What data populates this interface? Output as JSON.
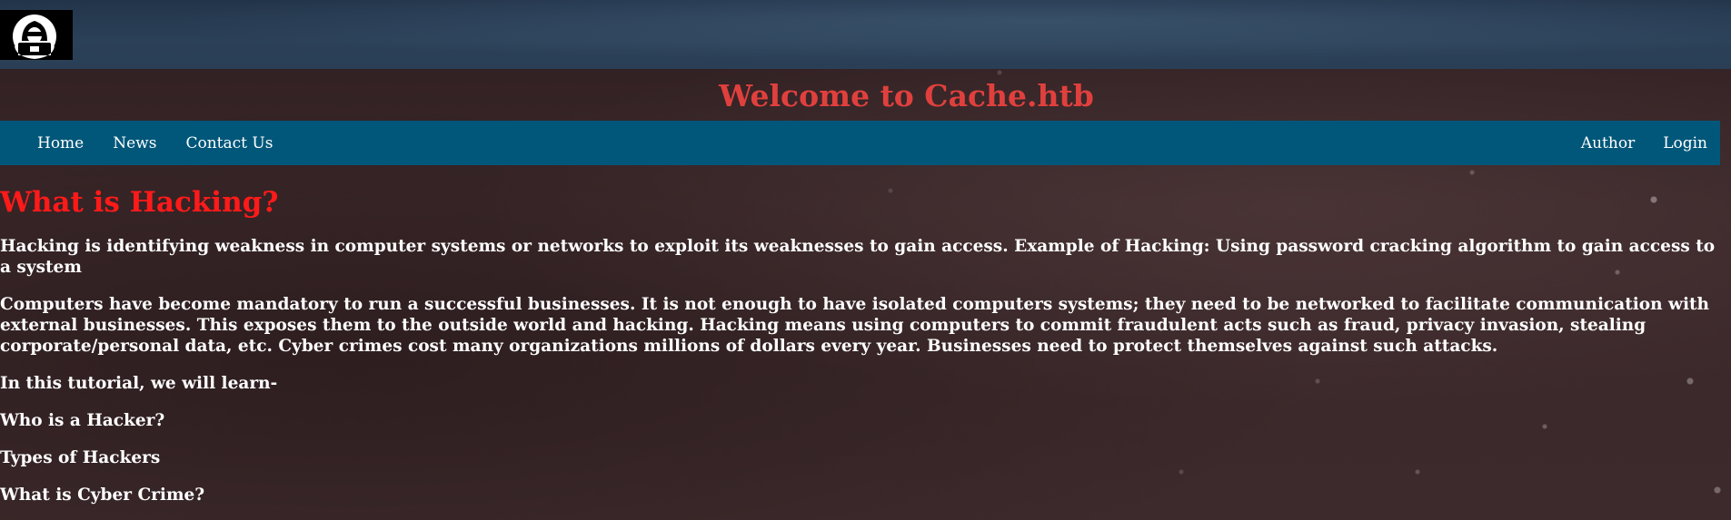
{
  "site": {
    "logo": "hacker-hood-logo",
    "title": "Welcome to Cache.htb"
  },
  "nav": {
    "left": [
      {
        "label": "Home"
      },
      {
        "label": "News"
      },
      {
        "label": "Contact Us"
      }
    ],
    "right": [
      {
        "label": "Author"
      },
      {
        "label": "Login"
      }
    ]
  },
  "article": {
    "heading": "What is Hacking?",
    "paragraphs": [
      "Hacking is identifying weakness in computer systems or networks to exploit its weaknesses to gain access. Example of Hacking: Using password cracking algorithm to gain access to a system",
      "Computers have become mandatory to run a successful businesses. It is not enough to have isolated computers systems; they need to be networked to facilitate communication with external businesses. This exposes them to the outside world and hacking. Hacking means using computers to commit fraudulent acts such as fraud, privacy invasion, stealing corporate/personal data, etc. Cyber crimes cost many organizations millions of dollars every year. Businesses need to protect themselves against such attacks.",
      "In this tutorial, we will learn-",
      "Who is a Hacker?",
      "Types of Hackers",
      "What is Cyber Crime?"
    ]
  },
  "colors": {
    "title": "#e0403d",
    "heading": "#ff1a1a",
    "navbar": "#01577a",
    "background": "#3a2729",
    "topbar": "#2b4158"
  }
}
